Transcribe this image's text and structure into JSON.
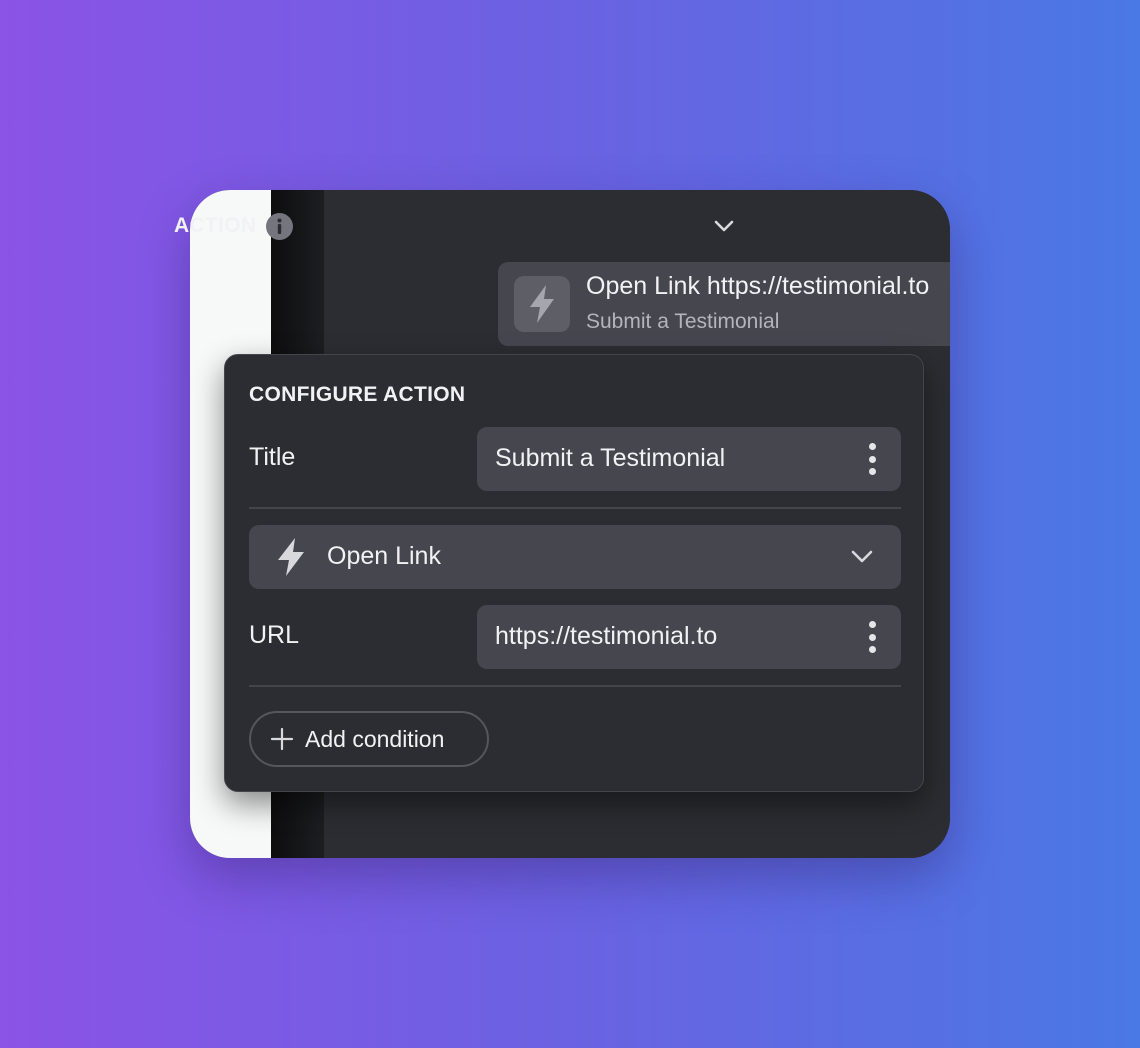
{
  "action_section": {
    "title": "ACTION",
    "selected": {
      "title": "Open Link https://testimonial.to",
      "subtitle": "Submit a Testimonial"
    }
  },
  "configure": {
    "title": "CONFIGURE ACTION",
    "title_field": {
      "label": "Title",
      "value": "Submit a Testimonial"
    },
    "action_type": {
      "value": "Open Link"
    },
    "url_field": {
      "label": "URL",
      "value": "https://testimonial.to"
    },
    "add_condition_label": "Add condition"
  },
  "icons": [
    "info-icon",
    "chevron-down-icon",
    "bolt-icon",
    "up-down-chevron-icon",
    "more-vertical-icon",
    "plus-icon"
  ],
  "colors": {
    "panel_bg": "#2c2d32",
    "field_bg": "#46464f",
    "text": "#f2f2f4",
    "muted_text": "#b4b4bb"
  }
}
